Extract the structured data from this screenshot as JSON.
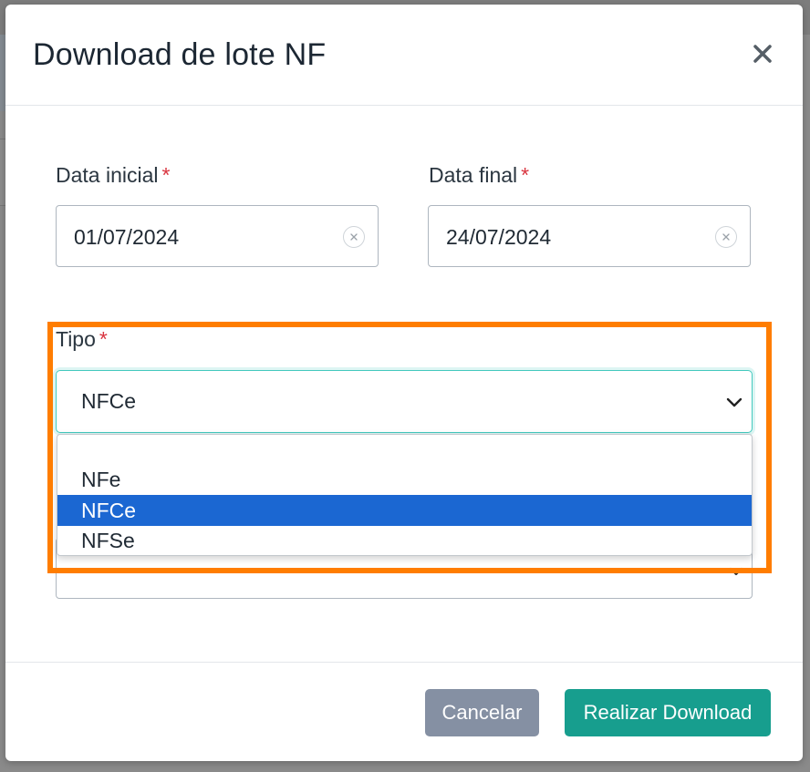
{
  "modal": {
    "title": "Download de lote NF"
  },
  "form": {
    "required_mark": "*",
    "start_date": {
      "label": "Data inicial",
      "value": "01/07/2024"
    },
    "end_date": {
      "label": "Data final",
      "value": "24/07/2024"
    },
    "type": {
      "label": "Tipo",
      "selected": "NFCe",
      "options": [
        "NFe",
        "NFCe",
        "NFSe"
      ]
    }
  },
  "footer": {
    "cancel_label": "Cancelar",
    "download_label": "Realizar Download"
  },
  "colors": {
    "accent": "#179e8e",
    "focus_border": "#44c9be",
    "option_selected": "#1b67d2",
    "cancel": "#8590a3",
    "required": "#d9343f",
    "highlight": "#ff7d00"
  },
  "icons": {
    "close": "close-icon",
    "clear": "clear-circle-x-icon",
    "chevron": "chevron-down-icon"
  }
}
